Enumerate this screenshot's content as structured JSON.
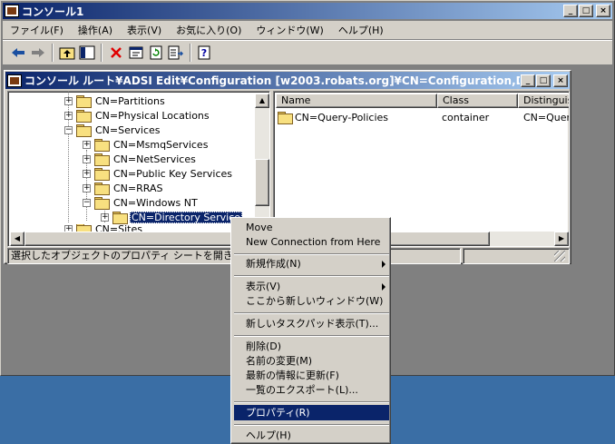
{
  "main_window": {
    "title": "コンソール1",
    "controls": {
      "minimize": "_",
      "maximize": "□",
      "close": "×"
    }
  },
  "menubar": {
    "items": [
      "ファイル(F)",
      "操作(A)",
      "表示(V)",
      "お気に入り(O)",
      "ウィンドウ(W)",
      "ヘルプ(H)"
    ]
  },
  "toolbar": {
    "icons": [
      "back-arrow-icon",
      "forward-arrow-icon",
      "up-folder-icon",
      "show-hide-tree-icon",
      "delete-icon",
      "properties-icon",
      "refresh-icon",
      "export-list-icon",
      "help-icon"
    ]
  },
  "child_window": {
    "title": "コンソール ルート¥ADSI Edit¥Configuration [w2003.robats.org]¥CN=Configuration,DC=robats..."
  },
  "tree": {
    "items": [
      {
        "label": "CN=Partitions"
      },
      {
        "label": "CN=Physical Locations"
      },
      {
        "label": "CN=Services"
      },
      {
        "label": "CN=MsmqServices"
      },
      {
        "label": "CN=NetServices"
      },
      {
        "label": "CN=Public Key Services"
      },
      {
        "label": "CN=RRAS"
      },
      {
        "label": "CN=Windows NT"
      },
      {
        "label": "CN=Directory Service"
      },
      {
        "label": "CN=Sites"
      }
    ]
  },
  "list": {
    "columns": [
      "Name",
      "Class",
      "Distinguis"
    ],
    "rows": [
      {
        "name": "CN=Query-Policies",
        "class": "container",
        "dn": "CN=Query"
      }
    ]
  },
  "statusbar": {
    "text": "選択したオブジェクトのプロパティ シートを開きます。"
  },
  "context_menu": {
    "items": [
      {
        "label": "Move"
      },
      {
        "label": "New Connection from Here"
      },
      {
        "label": "新規作成(N)"
      },
      {
        "label": "表示(V)"
      },
      {
        "label": "ここから新しいウィンドウ(W)"
      },
      {
        "label": "新しいタスクパッド表示(T)..."
      },
      {
        "label": "削除(D)"
      },
      {
        "label": "名前の変更(M)"
      },
      {
        "label": "最新の情報に更新(F)"
      },
      {
        "label": "一覧のエクスポート(L)..."
      },
      {
        "label": "プロパティ(R)"
      },
      {
        "label": "ヘルプ(H)"
      }
    ],
    "highlight_color": "#0a246a"
  }
}
